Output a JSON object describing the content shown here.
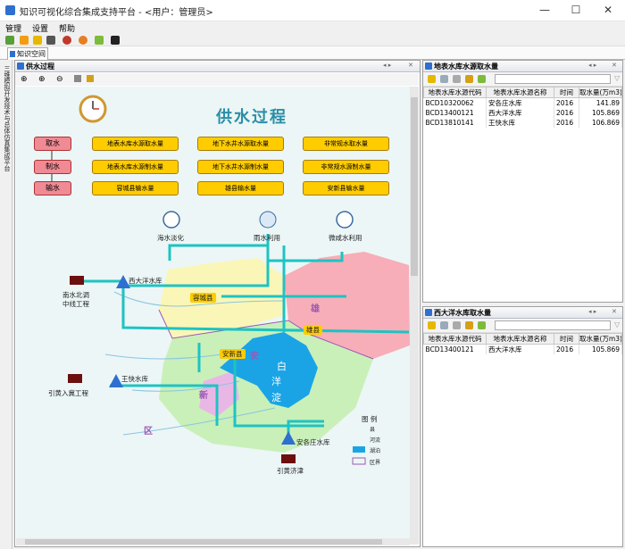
{
  "window": {
    "title": "知识可视化综合集成支持平台 - <用户：管理员>",
    "min": "—",
    "max": "☐",
    "close": "✕"
  },
  "menu": [
    "管理",
    "设置",
    "帮助"
  ],
  "doc_tab": "知识空间",
  "sidebar_text": "三维模拟开发技术与总体仿真集成平台",
  "main_panel": {
    "title": "供水过程"
  },
  "diagram": {
    "title": "供水过程",
    "flow": [
      "取水",
      "制水",
      "输水"
    ],
    "take": [
      "地表水库水源取水量",
      "地下水井水源取水量",
      "非常规水取水量"
    ],
    "make": [
      "地表水库水源制水量",
      "地下水井水源制水量",
      "非常规水源制水量"
    ],
    "deliver": [
      "容城县输水量",
      "雄县输水量",
      "安新县输水量"
    ],
    "sources": [
      "海水淡化",
      "雨水利用",
      "微咸水利用"
    ],
    "places": {
      "rongcheng": "容城县",
      "xiong": "雄县",
      "anxin": "安新县",
      "bai": "白",
      "yang": "洋",
      "dian": "淀",
      "xiong_red": "雄",
      "an": "安",
      "xin": "新",
      "qu": "区"
    },
    "reservoirs": {
      "xidayang": "西大洋水库",
      "wangkuai": "王快水库",
      "anzhuang": "安各庄水库"
    },
    "projects": {
      "nanshui": "南水北调",
      "nanshui2": "中线工程",
      "yinhuang": "引黄入冀工程",
      "yinhuang_jijin": "引黄济津"
    },
    "legend": {
      "title": "图  例",
      "items": [
        "县",
        "河流",
        "湖泊",
        "区界"
      ]
    }
  },
  "panel1": {
    "title": "地表水库水源取水量",
    "headers": [
      "地表水库水源代码",
      "地表水库水源名称",
      "时间",
      "取水量(万m3)"
    ],
    "rows": [
      [
        "BCD10320062",
        "安各庄水库",
        "2016",
        "141.89"
      ],
      [
        "BCD13400121",
        "西大洋水库",
        "2016",
        "105.869"
      ],
      [
        "BCD13810141",
        "王快水库",
        "2016",
        "106.869"
      ]
    ]
  },
  "panel2": {
    "title": "西大洋水库取水量",
    "headers": [
      "地表水库水源代码",
      "地表水库水源名称",
      "时间",
      "取水量(万m3)"
    ],
    "rows": [
      [
        "BCD13400121",
        "西大洋水库",
        "2016",
        "105.869"
      ]
    ]
  },
  "colors": {
    "accent": "#2f6fd0",
    "pipe": "#1ec3c3",
    "lake": "#1aa4e6",
    "pink_btn": "#f08a94",
    "yellow_btn": "#ffcc00"
  }
}
